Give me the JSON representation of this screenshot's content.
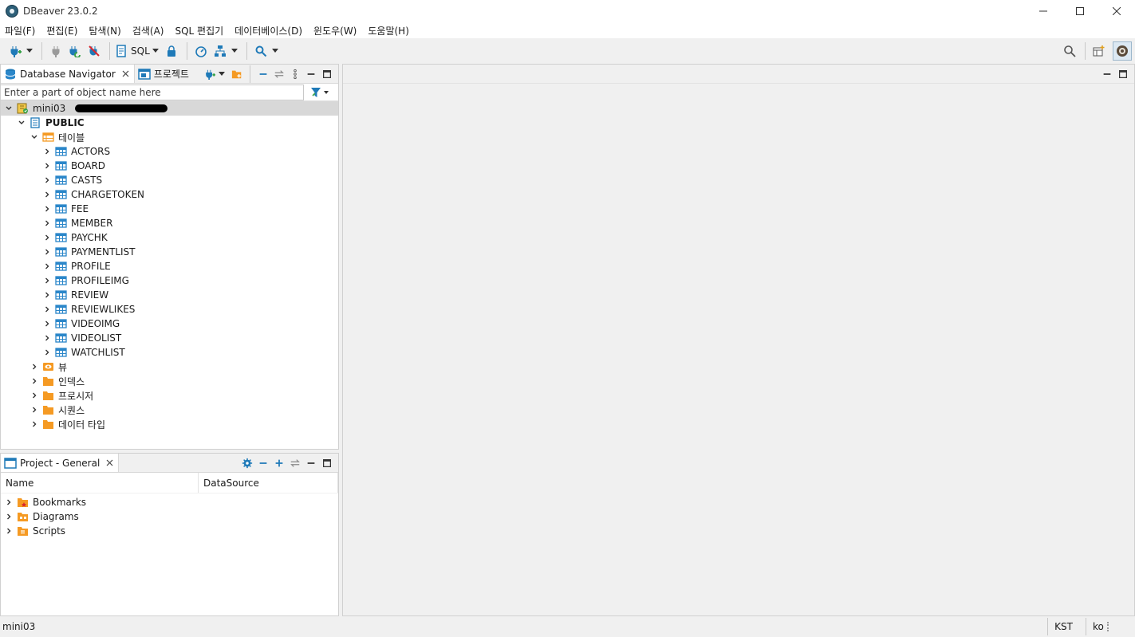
{
  "window": {
    "title": "DBeaver 23.0.2"
  },
  "menu": [
    "파일(F)",
    "편집(E)",
    "탐색(N)",
    "검색(A)",
    "SQL 편집기",
    "데이터베이스(D)",
    "윈도우(W)",
    "도움말(H)"
  ],
  "toolbar": {
    "sql_label": "SQL"
  },
  "navigator": {
    "tabs": [
      {
        "label": "Database Navigator",
        "icon": "database-navigator-icon"
      },
      {
        "label": "프로젝트",
        "icon": "projects-icon"
      }
    ],
    "filter_placeholder": "Enter a part of object name here",
    "connection": "mini03",
    "schema": "PUBLIC",
    "tables_folder": "테이블",
    "tables": [
      "ACTORS",
      "BOARD",
      "CASTS",
      "CHARGETOKEN",
      "FEE",
      "MEMBER",
      "PAYCHK",
      "PAYMENTLIST",
      "PROFILE",
      "PROFILEIMG",
      "REVIEW",
      "REVIEWLIKES",
      "VIDEOIMG",
      "VIDEOLIST",
      "WATCHLIST"
    ],
    "other_folders": [
      {
        "label": "뷰",
        "icon": "view-icon"
      },
      {
        "label": "인덱스",
        "icon": "folder-icon"
      },
      {
        "label": "프로시저",
        "icon": "folder-icon"
      },
      {
        "label": "시퀀스",
        "icon": "folder-icon"
      },
      {
        "label": "데이터 타입",
        "icon": "folder-icon"
      }
    ]
  },
  "project": {
    "tab_label": "Project - General",
    "columns": [
      "Name",
      "DataSource"
    ],
    "items": [
      {
        "label": "Bookmarks",
        "icon": "bookmarks-folder-icon"
      },
      {
        "label": "Diagrams",
        "icon": "diagrams-folder-icon"
      },
      {
        "label": "Scripts",
        "icon": "scripts-folder-icon"
      }
    ]
  },
  "status": {
    "left": "mini03",
    "timezone": "KST",
    "locale": "ko"
  },
  "colors": {
    "accent": "#1f7ab8",
    "folder": "#f59a23",
    "table": "#2a86c9"
  }
}
